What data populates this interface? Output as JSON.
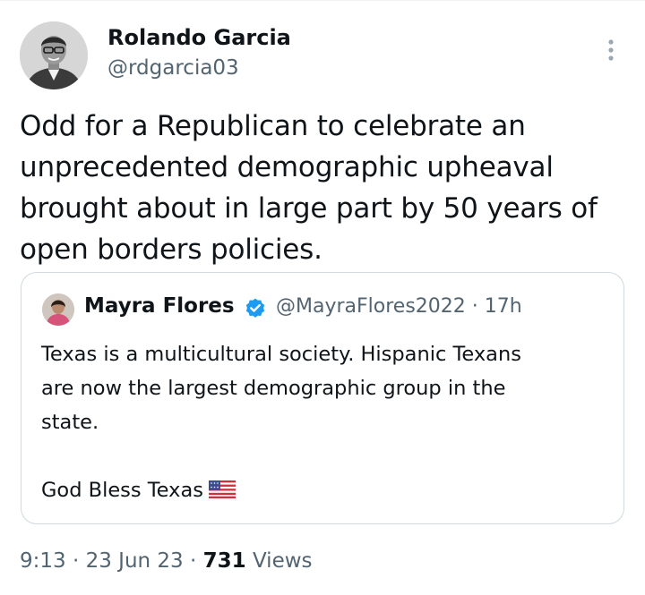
{
  "tweet": {
    "author": {
      "name": "Rolando Garcia",
      "handle": "@rdgarcia03"
    },
    "text_lines": [
      "Odd for a Republican to celebrate an",
      "unprecedented demographic upheaval",
      "brought about in large part by 50 years of",
      "open borders policies."
    ],
    "time": "9:13",
    "separator": "·",
    "date": "23 Jun 23",
    "views_count": "731",
    "views_label": "Views",
    "more_icon": "vertical-ellipsis-icon"
  },
  "quote": {
    "author": {
      "name": "Mayra Flores",
      "handle": "@MayraFlores2022",
      "verified": true,
      "verified_icon": "verified-badge-icon"
    },
    "age": "17h",
    "text_lines": [
      "Texas is a multicultural society. Hispanic Texans",
      "are now the largest demographic group in the",
      "state."
    ],
    "closing_line": "God Bless Texas",
    "emoji": "us-flag-emoji"
  },
  "colors": {
    "primary_text": "#0f1419",
    "secondary_text": "#536471",
    "border": "#cfd9de",
    "verified_blue": "#1d9bf0"
  }
}
